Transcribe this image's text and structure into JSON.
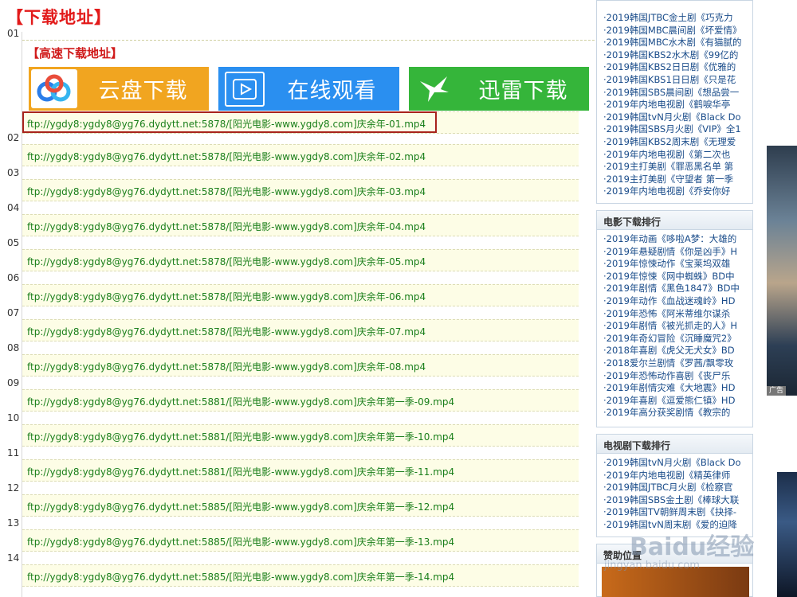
{
  "main": {
    "title": "【下载地址】",
    "high_speed_label": "【高速下载地址】",
    "buttons": {
      "yunpan": "云盘下载",
      "online": "在线观看",
      "xunlei": "迅雷下载"
    },
    "numbers": [
      "01",
      "02",
      "03",
      "04",
      "05",
      "06",
      "07",
      "08",
      "09",
      "10",
      "11",
      "12",
      "13",
      "14"
    ],
    "links": [
      "ftp://ygdy8:ygdy8@yg76.dydytt.net:5878/[阳光电影-www.ygdy8.com]庆余年-01.mp4",
      "ftp://ygdy8:ygdy8@yg76.dydytt.net:5878/[阳光电影-www.ygdy8.com]庆余年-02.mp4",
      "ftp://ygdy8:ygdy8@yg76.dydytt.net:5878/[阳光电影-www.ygdy8.com]庆余年-03.mp4",
      "ftp://ygdy8:ygdy8@yg76.dydytt.net:5878/[阳光电影-www.ygdy8.com]庆余年-04.mp4",
      "ftp://ygdy8:ygdy8@yg76.dydytt.net:5878/[阳光电影-www.ygdy8.com]庆余年-05.mp4",
      "ftp://ygdy8:ygdy8@yg76.dydytt.net:5878/[阳光电影-www.ygdy8.com]庆余年-06.mp4",
      "ftp://ygdy8:ygdy8@yg76.dydytt.net:5878/[阳光电影-www.ygdy8.com]庆余年-07.mp4",
      "ftp://ygdy8:ygdy8@yg76.dydytt.net:5878/[阳光电影-www.ygdy8.com]庆余年-08.mp4",
      "ftp://ygdy8:ygdy8@yg76.dydytt.net:5881/[阳光电影-www.ygdy8.com]庆余年第一季-09.mp4",
      "ftp://ygdy8:ygdy8@yg76.dydytt.net:5881/[阳光电影-www.ygdy8.com]庆余年第一季-10.mp4",
      "ftp://ygdy8:ygdy8@yg76.dydytt.net:5881/[阳光电影-www.ygdy8.com]庆余年第一季-11.mp4",
      "ftp://ygdy8:ygdy8@yg76.dydytt.net:5885/[阳光电影-www.ygdy8.com]庆余年第一季-12.mp4",
      "ftp://ygdy8:ygdy8@yg76.dydytt.net:5885/[阳光电影-www.ygdy8.com]庆余年第一季-13.mp4",
      "ftp://ygdy8:ygdy8@yg76.dydytt.net:5885/[阳光电影-www.ygdy8.com]庆余年第一季-14.mp4"
    ]
  },
  "sidebar": {
    "top_list": [
      "2019韩国JTBC金土剧《巧克力",
      "2019韩国MBC晨间剧《坏爱情》",
      "2019韩国MBC水木剧《有猫腻的",
      "2019韩国KBS2水木剧《99亿的",
      "2019韩国KBS2日日剧《优雅的",
      "2019韩国KBS1日日剧《只是花",
      "2019韩国SBS晨间剧《想品尝一",
      "2019年内地电视剧《鹤唳华亭",
      "2019韩国tvN月火剧《Black Do",
      "2019韩国SBS月火剧《VIP》全1",
      "2019韩国KBS2周末剧《无理爱",
      "2019年内地电视剧《第二次也",
      "2019主打美剧《罪恶黑名单 第",
      "2019主打美剧《守望者 第一季",
      "2019年内地电视剧《乔安你好"
    ],
    "movie_rank": {
      "title": "电影下载排行",
      "items": [
        "2019年动画《哆啦A梦：大雄的",
        "2019年悬疑剧情《你是凶手》H",
        "2019年惊悚动作《宝莱坞双雄",
        "2019年惊悚《网中蜘蛛》BD中",
        "2019年剧情《黑色1847》BD中",
        "2019年动作《血战迷魂岭》HD",
        "2019年恐怖《阿米蒂维尔谋杀",
        "2019年剧情《被光抓走的人》H",
        "2019年奇幻冒险《沉睡魔咒2》",
        "2018年喜剧《虎父无犬女》BD",
        "2018爱尔兰剧情《罗茜/飘零玫",
        "2019年恐怖动作喜剧《丧尸乐",
        "2019年剧情灾难《大地震》HD",
        "2019年喜剧《逗爱熊仁镇》HD",
        "2019年高分获奖剧情《教宗的"
      ]
    },
    "tv_rank": {
      "title": "电视剧下载排行",
      "items": [
        "2019韩国tvN月火剧《Black Do",
        "2019年内地电视剧《精英律师",
        "2019韩国JTBC月火剧《检察官",
        "2019韩国SBS金土剧《棒球大联",
        "2019韩国TV朝鲜周末剧《抉择-",
        "2019韩国tvN周末剧《爱的迫降"
      ]
    },
    "sponsor_title": "赞助位置",
    "ad_tag": "广告"
  },
  "watermark": {
    "logo": "Baidu经验",
    "url": "jingyan.baidu.com"
  }
}
